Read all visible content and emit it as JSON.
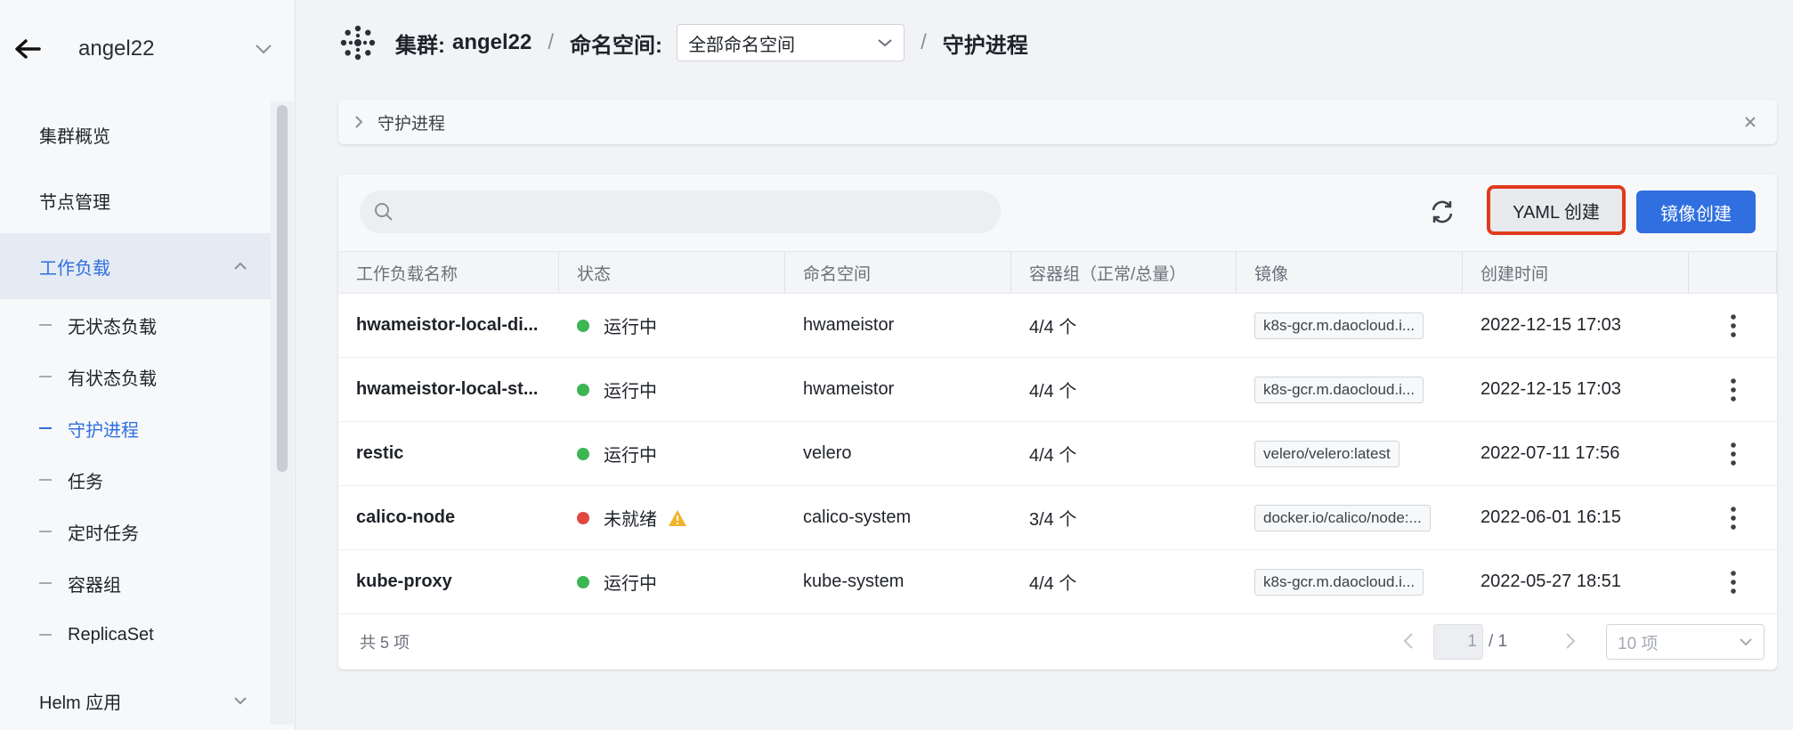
{
  "sidebar": {
    "cluster_name": "angel22",
    "items": [
      {
        "label": "集群概览"
      },
      {
        "label": "节点管理"
      },
      {
        "label": "工作负载"
      }
    ],
    "sub_items": [
      {
        "label": "无状态负载"
      },
      {
        "label": "有状态负载"
      },
      {
        "label": "守护进程"
      },
      {
        "label": "任务"
      },
      {
        "label": "定时任务"
      },
      {
        "label": "容器组"
      },
      {
        "label": "ReplicaSet"
      }
    ],
    "helm_label": "Helm 应用"
  },
  "breadcrumb": {
    "cluster_label": "集群:",
    "cluster_value": "angel22",
    "sep": "/",
    "namespace_label": "命名空间:",
    "namespace_value": "全部命名空间",
    "current": "守护进程"
  },
  "banner": {
    "text": "守护进程"
  },
  "toolbar": {
    "search_placeholder": "",
    "yaml_label": "YAML 创建",
    "image_label": "镜像创建"
  },
  "table": {
    "headers": [
      "工作负载名称",
      "状态",
      "命名空间",
      "容器组（正常/总量）",
      "镜像",
      "创建时间"
    ],
    "rows": [
      {
        "name": "hwameistor-local-di...",
        "status": "运行中",
        "status_color": "#3cb553",
        "namespace": "hwameistor",
        "pods": "4/4 个",
        "image": "k8s-gcr.m.daocloud.i...",
        "created": "2022-12-15 17:03",
        "warn": false
      },
      {
        "name": "hwameistor-local-st...",
        "status": "运行中",
        "status_color": "#3cb553",
        "namespace": "hwameistor",
        "pods": "4/4 个",
        "image": "k8s-gcr.m.daocloud.i...",
        "created": "2022-12-15 17:03",
        "warn": false
      },
      {
        "name": "restic",
        "status": "运行中",
        "status_color": "#3cb553",
        "namespace": "velero",
        "pods": "4/4 个",
        "image": "velero/velero:latest",
        "created": "2022-07-11 17:56",
        "warn": false
      },
      {
        "name": "calico-node",
        "status": "未就绪",
        "status_color": "#e2473f",
        "namespace": "calico-system",
        "pods": "3/4 个",
        "image": "docker.io/calico/node:...",
        "created": "2022-06-01 16:15",
        "warn": true
      },
      {
        "name": "kube-proxy",
        "status": "运行中",
        "status_color": "#3cb553",
        "namespace": "kube-system",
        "pods": "4/4 个",
        "image": "k8s-gcr.m.daocloud.i...",
        "created": "2022-05-27 18:51",
        "warn": false
      }
    ]
  },
  "footer": {
    "total": "共 5 项",
    "page_current": "1",
    "page_total": "/ 1",
    "page_size": "10 项"
  },
  "colors": {
    "accent": "#2f6fe0",
    "highlight_border": "#e03a1e",
    "running": "#3cb553",
    "not_ready": "#e2473f",
    "warning": "#f0b429"
  }
}
